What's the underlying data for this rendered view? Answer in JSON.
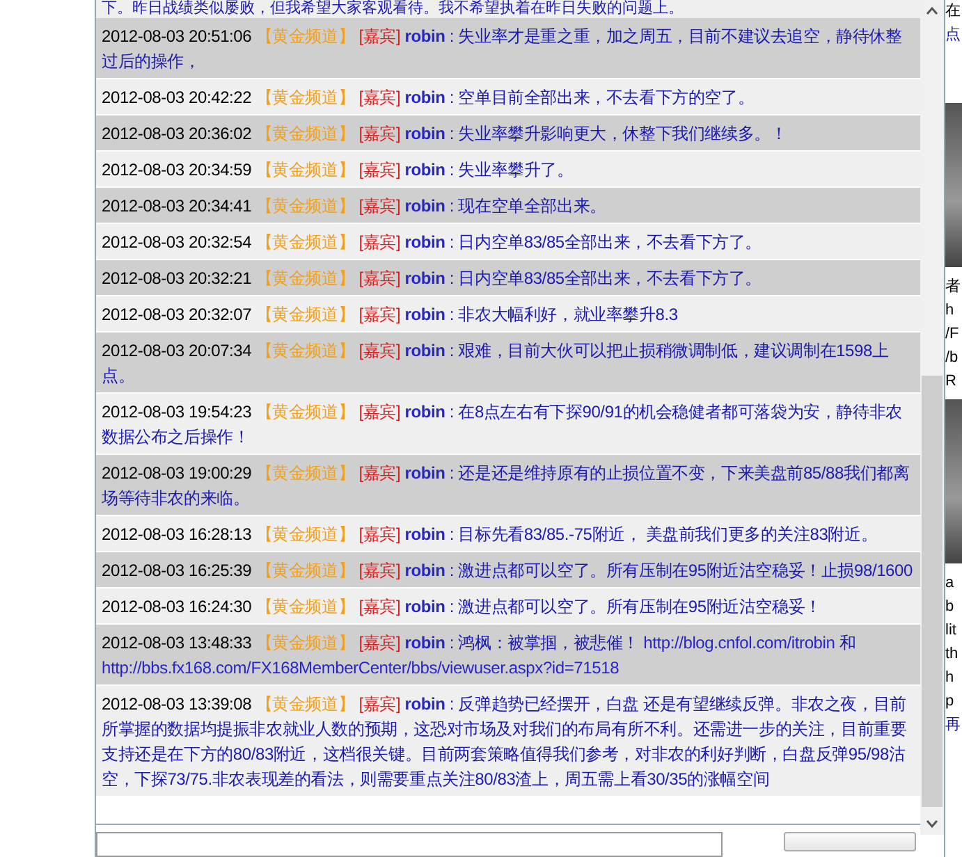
{
  "chat": {
    "cut_off_message": "下。昨日战绩类似屡败，但我希望大家客观看待。我不希望执着在昨日失败的问题上。",
    "messages": [
      {
        "time": "2012-08-03 20:51:06",
        "channel": "【黄金频道】",
        "role": "[嘉宾]",
        "user": "robin",
        "segments": [
          {
            "kind": "text",
            "text": ": 失业率才是重之重，加之周五，目前不建议去追空，静待休整过后的操作，"
          }
        ]
      },
      {
        "time": "2012-08-03 20:42:22",
        "channel": "【黄金频道】",
        "role": "[嘉宾]",
        "user": "robin",
        "segments": [
          {
            "kind": "text",
            "text": ": 空单目前全部出来，不去看下方的空了。"
          }
        ]
      },
      {
        "time": "2012-08-03 20:36:02",
        "channel": "【黄金频道】",
        "role": "[嘉宾]",
        "user": "robin",
        "segments": [
          {
            "kind": "text",
            "text": ": 失业率攀升影响更大，休整下我们继续多。！"
          }
        ]
      },
      {
        "time": "2012-08-03 20:34:59",
        "channel": "【黄金频道】",
        "role": "[嘉宾]",
        "user": "robin",
        "segments": [
          {
            "kind": "text",
            "text": ": 失业率攀升了。"
          }
        ]
      },
      {
        "time": "2012-08-03 20:34:41",
        "channel": "【黄金频道】",
        "role": "[嘉宾]",
        "user": "robin",
        "segments": [
          {
            "kind": "text",
            "text": ": 现在空单全部出来。"
          }
        ]
      },
      {
        "time": "2012-08-03 20:32:54",
        "channel": "【黄金频道】",
        "role": "[嘉宾]",
        "user": "robin",
        "segments": [
          {
            "kind": "text",
            "text": ": 日内空单83/85全部出来，不去看下方了。"
          }
        ]
      },
      {
        "time": "2012-08-03 20:32:21",
        "channel": "【黄金频道】",
        "role": "[嘉宾]",
        "user": "robin",
        "segments": [
          {
            "kind": "text",
            "text": ": 日内空单83/85全部出来，不去看下方了。"
          }
        ]
      },
      {
        "time": "2012-08-03 20:32:07",
        "channel": "【黄金频道】",
        "role": "[嘉宾]",
        "user": "robin",
        "segments": [
          {
            "kind": "text",
            "text": ": 非农大幅利好，就业率攀升8.3"
          }
        ]
      },
      {
        "time": "2012-08-03 20:07:34",
        "channel": "【黄金频道】",
        "role": "[嘉宾]",
        "user": "robin",
        "segments": [
          {
            "kind": "text",
            "text": ": 艰难，目前大伙可以把止损稍微调制低，建议调制在1598上点。"
          }
        ]
      },
      {
        "time": "2012-08-03 19:54:23",
        "channel": "【黄金频道】",
        "role": "[嘉宾]",
        "user": "robin",
        "segments": [
          {
            "kind": "text",
            "text": ": 在8点左右有下探90/91的机会稳健者都可落袋为安，静待非农数据公布之后操作！"
          }
        ]
      },
      {
        "time": "2012-08-03 19:00:29",
        "channel": "【黄金频道】",
        "role": "[嘉宾]",
        "user": "robin",
        "segments": [
          {
            "kind": "text",
            "text": ": 还是还是维持原有的止损位置不变，下来美盘前85/88我们都离场等待非农的来临。"
          }
        ]
      },
      {
        "time": "2012-08-03 16:28:13",
        "channel": "【黄金频道】",
        "role": "[嘉宾]",
        "user": "robin",
        "segments": [
          {
            "kind": "text",
            "text": ": 目标先看83/85.-75附近， 美盘前我们更多的关注83附近。"
          }
        ]
      },
      {
        "time": "2012-08-03 16:25:39",
        "channel": "【黄金频道】",
        "role": "[嘉宾]",
        "user": "robin",
        "segments": [
          {
            "kind": "text",
            "text": ": 激进点都可以空了。所有压制在95附近沽空稳妥！止损98/1600"
          }
        ]
      },
      {
        "time": "2012-08-03 16:24:30",
        "channel": "【黄金频道】",
        "role": "[嘉宾]",
        "user": "robin",
        "segments": [
          {
            "kind": "text",
            "text": ": 激进点都可以空了。所有压制在95附近沽空稳妥！"
          }
        ]
      },
      {
        "time": "2012-08-03 13:48:33",
        "channel": "【黄金频道】",
        "role": "[嘉宾]",
        "user": "robin",
        "segments": [
          {
            "kind": "text",
            "text": ": 鸿枫：被掌掴，被悲催！"
          },
          {
            "kind": "link",
            "text": "http://blog.cnfol.com/itrobin"
          },
          {
            "kind": "text",
            "text": "和"
          },
          {
            "kind": "link",
            "text": "http://bbs.fx168.com/FX168MemberCenter/bbs/viewuser.aspx?id=71518"
          }
        ]
      },
      {
        "time": "2012-08-03 13:39:08",
        "channel": "【黄金频道】",
        "role": "[嘉宾]",
        "user": "robin",
        "segments": [
          {
            "kind": "text",
            "text": ": 反弹趋势已经摆开，白盘 还是有望继续反弹。非农之夜，目前所掌握的数据均提振非农就业人数的预期，这恐对市场及对我们的布局有所不利。还需进一步的关注，目前重要支持还是在下方的80/83附近，这档很关键。目前两套策略值得我们参考，对非农的利好判断，白盘反弹95/98沽空，下探73/75.非农表现差的看法，则需要重点关注80/83渣上，周五需上看30/35的涨幅空间"
          }
        ]
      }
    ]
  },
  "side_strip": [
    {
      "kind": "text",
      "text": "在"
    },
    {
      "kind": "link",
      "text": "点"
    },
    {
      "kind": "photo"
    },
    {
      "kind": "text",
      "text": "者"
    },
    {
      "kind": "text",
      "text": "h"
    },
    {
      "kind": "text",
      "text": "/F"
    },
    {
      "kind": "text",
      "text": "/b"
    },
    {
      "kind": "text",
      "text": "R"
    },
    {
      "kind": "photo"
    },
    {
      "kind": "text",
      "text": "a"
    },
    {
      "kind": "text",
      "text": "b"
    },
    {
      "kind": "text",
      "text": "lit"
    },
    {
      "kind": "text",
      "text": "th"
    },
    {
      "kind": "text",
      "text": "h"
    },
    {
      "kind": "text",
      "text": "p"
    },
    {
      "kind": "link",
      "text": "再"
    }
  ]
}
